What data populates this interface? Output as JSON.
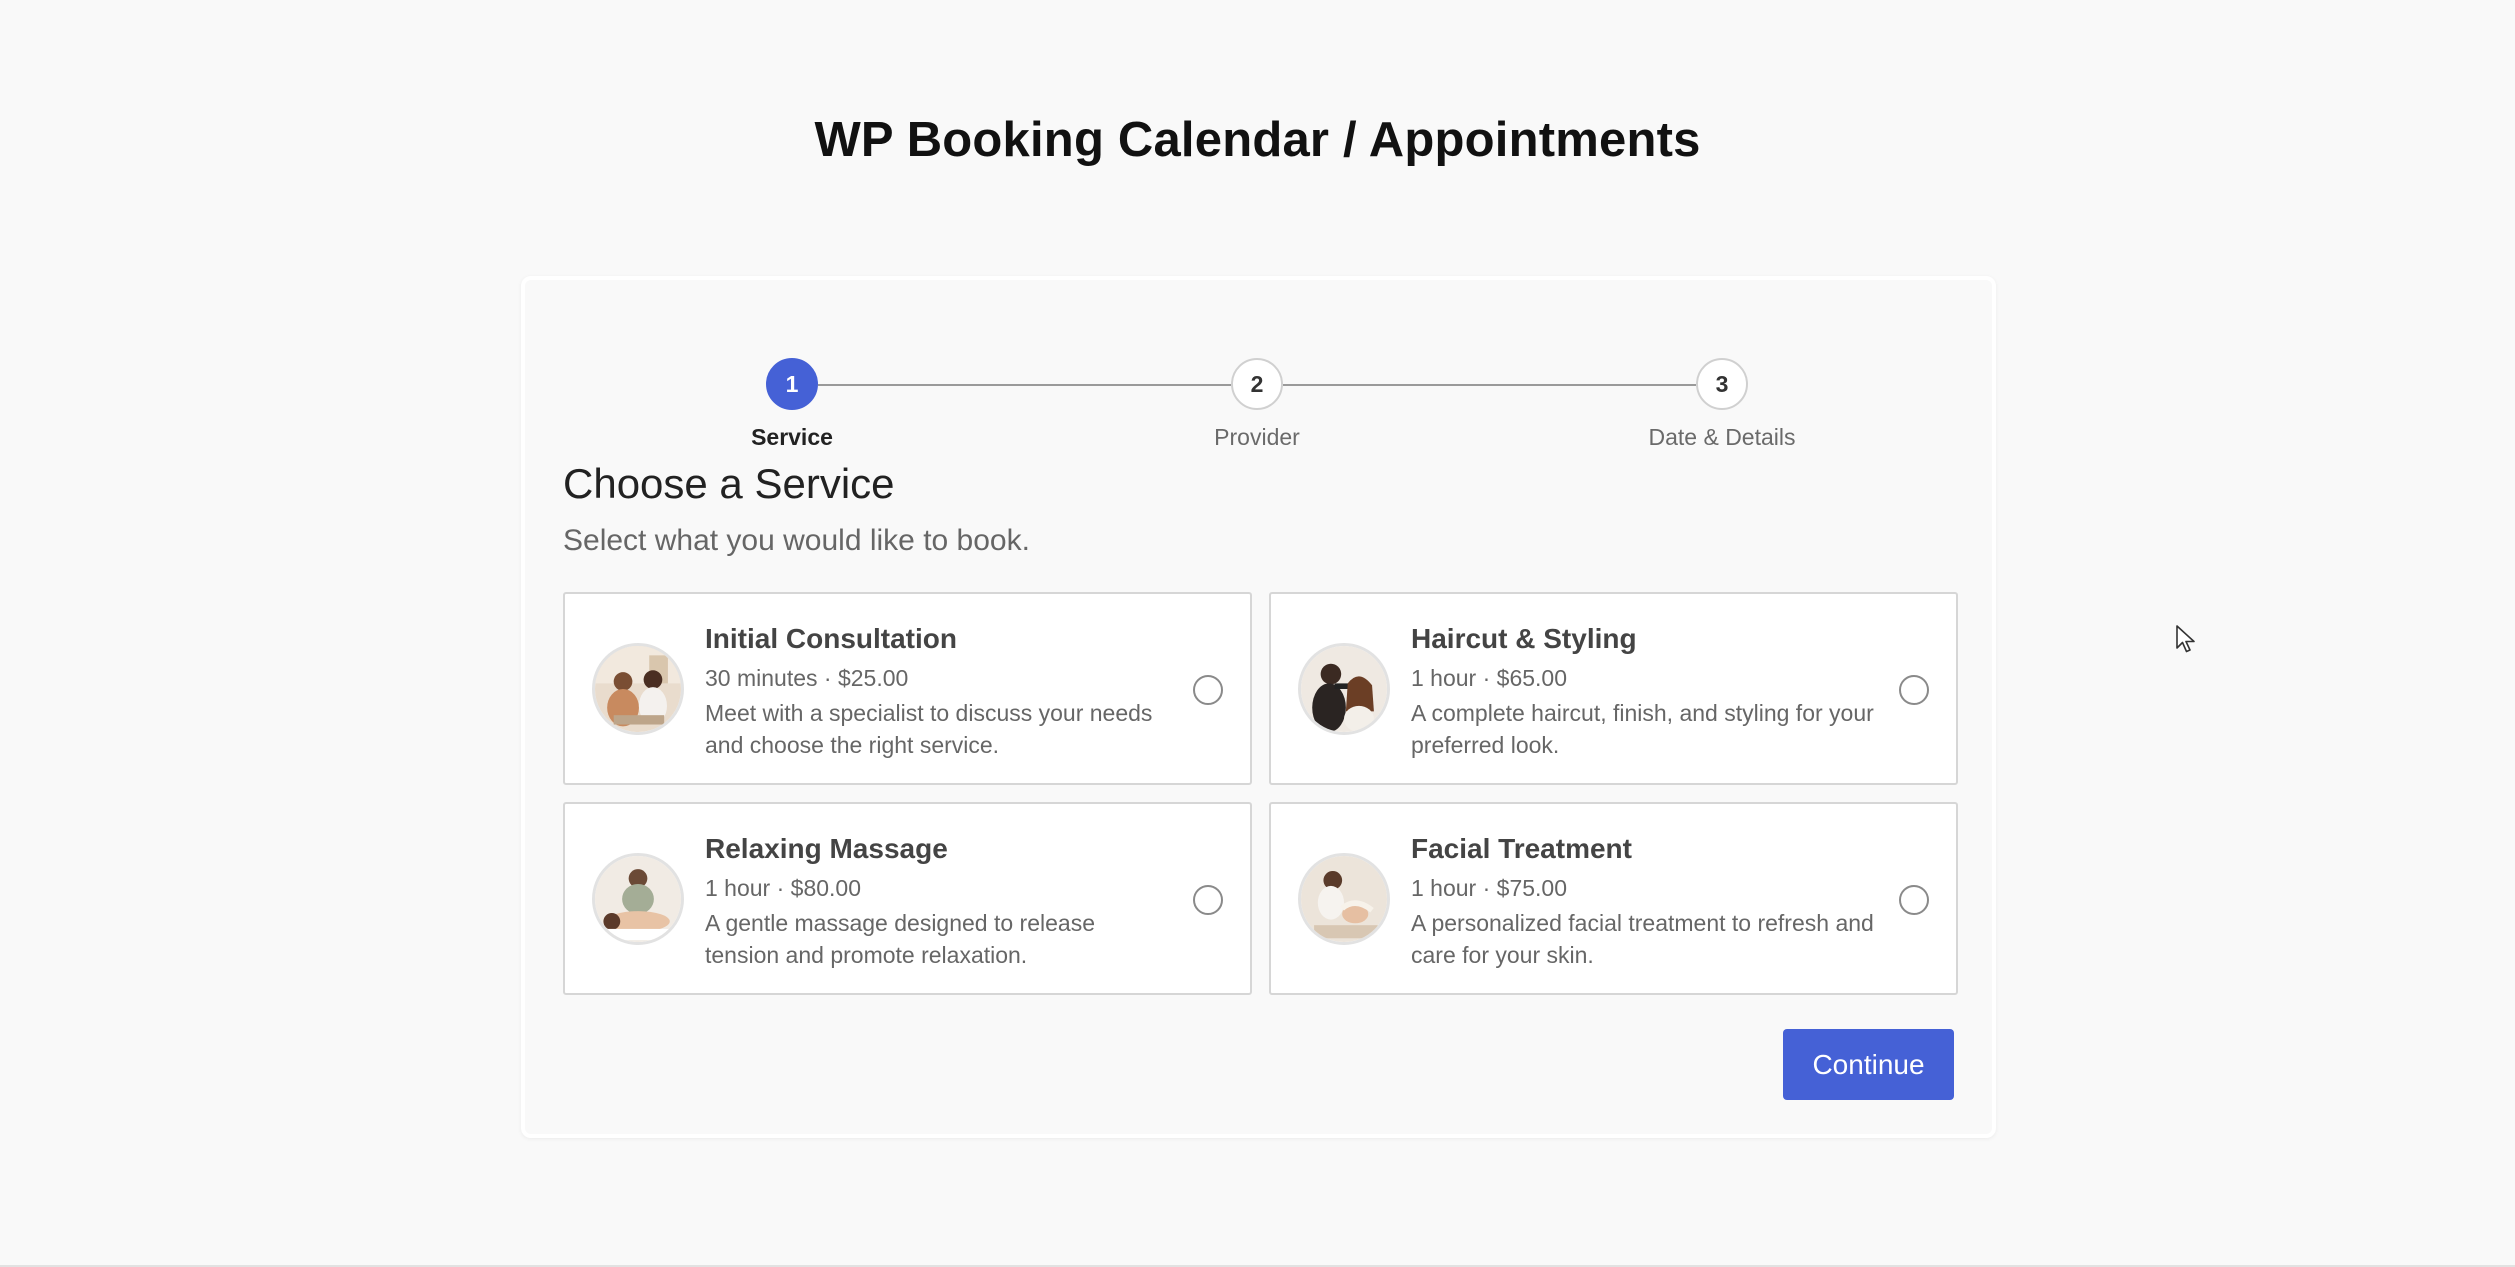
{
  "page": {
    "title": "WP Booking Calendar / Appointments"
  },
  "stepper": {
    "steps": [
      {
        "number": "1",
        "label": "Service",
        "active": true
      },
      {
        "number": "2",
        "label": "Provider",
        "active": false
      },
      {
        "number": "3",
        "label": "Date & Details",
        "active": false
      }
    ]
  },
  "section": {
    "title": "Choose a Service",
    "subtitle": "Select what you would like to book."
  },
  "services": [
    {
      "name": "Initial Consultation",
      "meta": "30 minutes · $25.00",
      "description": "Meet with a specialist to discuss your needs and choose the right service.",
      "image_icon": "consultation-photo",
      "selected": false
    },
    {
      "name": "Haircut & Styling",
      "meta": "1 hour · $65.00",
      "description": "A complete haircut, finish, and styling for your preferred look.",
      "image_icon": "haircut-photo",
      "selected": false
    },
    {
      "name": "Relaxing Massage",
      "meta": "1 hour · $80.00",
      "description": "A gentle massage designed to release tension and promote relaxation.",
      "image_icon": "massage-photo",
      "selected": false
    },
    {
      "name": "Facial Treatment",
      "meta": "1 hour · $75.00",
      "description": "A personalized facial treatment to refresh and care for your skin.",
      "image_icon": "facial-photo",
      "selected": false
    }
  ],
  "actions": {
    "continue_label": "Continue"
  },
  "colors": {
    "accent": "#4561d6",
    "background": "#f9f9f9",
    "card_border": "#d6d6d6"
  }
}
